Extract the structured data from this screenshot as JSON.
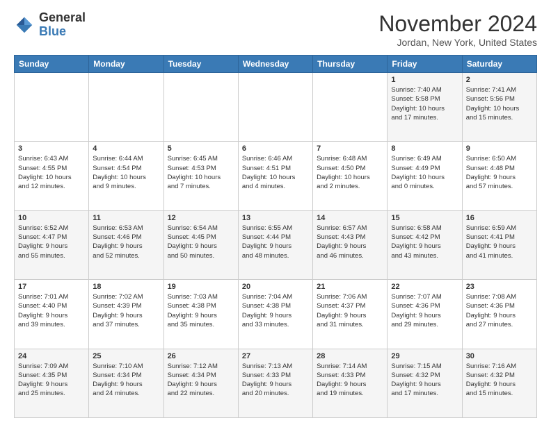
{
  "logo": {
    "general": "General",
    "blue": "Blue"
  },
  "title": "November 2024",
  "location": "Jordan, New York, United States",
  "days_header": [
    "Sunday",
    "Monday",
    "Tuesday",
    "Wednesday",
    "Thursday",
    "Friday",
    "Saturday"
  ],
  "weeks": [
    [
      {
        "day": "",
        "info": ""
      },
      {
        "day": "",
        "info": ""
      },
      {
        "day": "",
        "info": ""
      },
      {
        "day": "",
        "info": ""
      },
      {
        "day": "",
        "info": ""
      },
      {
        "day": "1",
        "info": "Sunrise: 7:40 AM\nSunset: 5:58 PM\nDaylight: 10 hours\nand 17 minutes."
      },
      {
        "day": "2",
        "info": "Sunrise: 7:41 AM\nSunset: 5:56 PM\nDaylight: 10 hours\nand 15 minutes."
      }
    ],
    [
      {
        "day": "3",
        "info": "Sunrise: 6:43 AM\nSunset: 4:55 PM\nDaylight: 10 hours\nand 12 minutes."
      },
      {
        "day": "4",
        "info": "Sunrise: 6:44 AM\nSunset: 4:54 PM\nDaylight: 10 hours\nand 9 minutes."
      },
      {
        "day": "5",
        "info": "Sunrise: 6:45 AM\nSunset: 4:53 PM\nDaylight: 10 hours\nand 7 minutes."
      },
      {
        "day": "6",
        "info": "Sunrise: 6:46 AM\nSunset: 4:51 PM\nDaylight: 10 hours\nand 4 minutes."
      },
      {
        "day": "7",
        "info": "Sunrise: 6:48 AM\nSunset: 4:50 PM\nDaylight: 10 hours\nand 2 minutes."
      },
      {
        "day": "8",
        "info": "Sunrise: 6:49 AM\nSunset: 4:49 PM\nDaylight: 10 hours\nand 0 minutes."
      },
      {
        "day": "9",
        "info": "Sunrise: 6:50 AM\nSunset: 4:48 PM\nDaylight: 9 hours\nand 57 minutes."
      }
    ],
    [
      {
        "day": "10",
        "info": "Sunrise: 6:52 AM\nSunset: 4:47 PM\nDaylight: 9 hours\nand 55 minutes."
      },
      {
        "day": "11",
        "info": "Sunrise: 6:53 AM\nSunset: 4:46 PM\nDaylight: 9 hours\nand 52 minutes."
      },
      {
        "day": "12",
        "info": "Sunrise: 6:54 AM\nSunset: 4:45 PM\nDaylight: 9 hours\nand 50 minutes."
      },
      {
        "day": "13",
        "info": "Sunrise: 6:55 AM\nSunset: 4:44 PM\nDaylight: 9 hours\nand 48 minutes."
      },
      {
        "day": "14",
        "info": "Sunrise: 6:57 AM\nSunset: 4:43 PM\nDaylight: 9 hours\nand 46 minutes."
      },
      {
        "day": "15",
        "info": "Sunrise: 6:58 AM\nSunset: 4:42 PM\nDaylight: 9 hours\nand 43 minutes."
      },
      {
        "day": "16",
        "info": "Sunrise: 6:59 AM\nSunset: 4:41 PM\nDaylight: 9 hours\nand 41 minutes."
      }
    ],
    [
      {
        "day": "17",
        "info": "Sunrise: 7:01 AM\nSunset: 4:40 PM\nDaylight: 9 hours\nand 39 minutes."
      },
      {
        "day": "18",
        "info": "Sunrise: 7:02 AM\nSunset: 4:39 PM\nDaylight: 9 hours\nand 37 minutes."
      },
      {
        "day": "19",
        "info": "Sunrise: 7:03 AM\nSunset: 4:38 PM\nDaylight: 9 hours\nand 35 minutes."
      },
      {
        "day": "20",
        "info": "Sunrise: 7:04 AM\nSunset: 4:38 PM\nDaylight: 9 hours\nand 33 minutes."
      },
      {
        "day": "21",
        "info": "Sunrise: 7:06 AM\nSunset: 4:37 PM\nDaylight: 9 hours\nand 31 minutes."
      },
      {
        "day": "22",
        "info": "Sunrise: 7:07 AM\nSunset: 4:36 PM\nDaylight: 9 hours\nand 29 minutes."
      },
      {
        "day": "23",
        "info": "Sunrise: 7:08 AM\nSunset: 4:36 PM\nDaylight: 9 hours\nand 27 minutes."
      }
    ],
    [
      {
        "day": "24",
        "info": "Sunrise: 7:09 AM\nSunset: 4:35 PM\nDaylight: 9 hours\nand 25 minutes."
      },
      {
        "day": "25",
        "info": "Sunrise: 7:10 AM\nSunset: 4:34 PM\nDaylight: 9 hours\nand 24 minutes."
      },
      {
        "day": "26",
        "info": "Sunrise: 7:12 AM\nSunset: 4:34 PM\nDaylight: 9 hours\nand 22 minutes."
      },
      {
        "day": "27",
        "info": "Sunrise: 7:13 AM\nSunset: 4:33 PM\nDaylight: 9 hours\nand 20 minutes."
      },
      {
        "day": "28",
        "info": "Sunrise: 7:14 AM\nSunset: 4:33 PM\nDaylight: 9 hours\nand 19 minutes."
      },
      {
        "day": "29",
        "info": "Sunrise: 7:15 AM\nSunset: 4:32 PM\nDaylight: 9 hours\nand 17 minutes."
      },
      {
        "day": "30",
        "info": "Sunrise: 7:16 AM\nSunset: 4:32 PM\nDaylight: 9 hours\nand 15 minutes."
      }
    ]
  ]
}
